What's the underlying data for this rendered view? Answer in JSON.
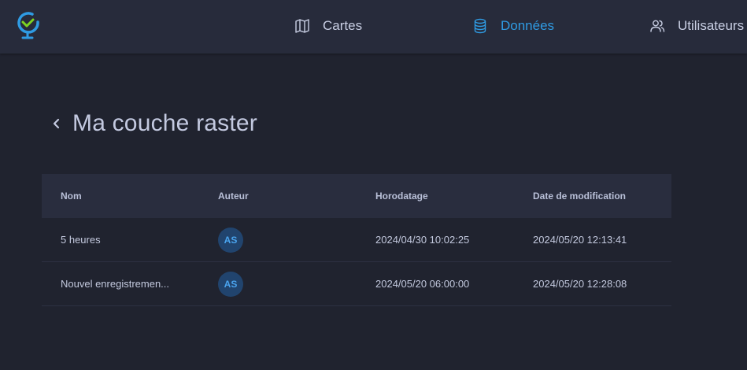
{
  "nav": {
    "items": [
      {
        "label": "Cartes",
        "icon": "map-icon",
        "active": false
      },
      {
        "label": "Données",
        "icon": "database-icon",
        "active": true
      },
      {
        "label": "Utilisateurs",
        "icon": "users-icon",
        "active": false
      }
    ]
  },
  "page": {
    "title": "Ma couche raster"
  },
  "table": {
    "columns": [
      "Nom",
      "Auteur",
      "Horodatage",
      "Date de modification"
    ],
    "rows": [
      {
        "name": "5 heures",
        "author": "AS",
        "timestamp": "2024/04/30 10:02:25",
        "modified": "2024/05/20 12:13:41"
      },
      {
        "name": "Nouvel enregistremen...",
        "author": "AS",
        "timestamp": "2024/05/20 06:00:00",
        "modified": "2024/05/20 12:28:08"
      }
    ]
  },
  "colors": {
    "accent": "#2f9be3",
    "background": "#20232f",
    "topbar": "#272b3b",
    "avatar_bg": "#21446e"
  }
}
